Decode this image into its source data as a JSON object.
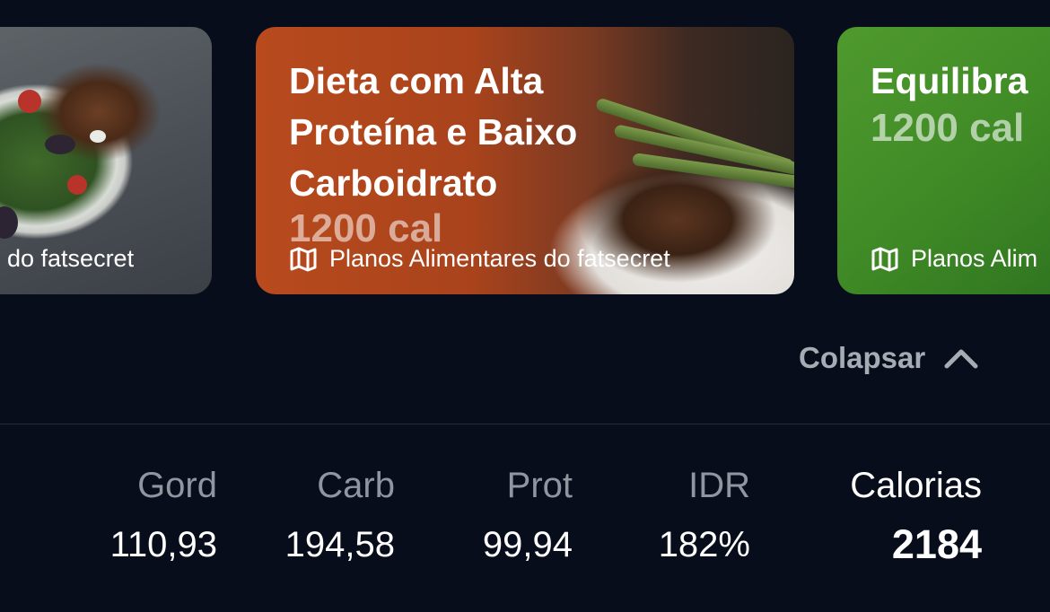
{
  "carousel": {
    "cards": [
      {
        "source": "do fatsecret"
      },
      {
        "title": "Dieta com Alta Proteína e Baixo Carboidrato",
        "calories": "1200 cal",
        "source": "Planos Alimentares do fatsecret"
      },
      {
        "title": "Equilibra",
        "calories": "1200 cal",
        "source": "Planos Alim"
      }
    ]
  },
  "collapse": {
    "label": "Colapsar",
    "icon": "chevron-up-icon"
  },
  "nutrition": {
    "fat": {
      "label": "Gord",
      "value": "110,93"
    },
    "carb": {
      "label": "Carb",
      "value": "194,58"
    },
    "prot": {
      "label": "Prot",
      "value": "99,94"
    },
    "rdi": {
      "label": "IDR",
      "value": "182%"
    },
    "calories": {
      "label": "Calorias",
      "value": "2184"
    }
  }
}
